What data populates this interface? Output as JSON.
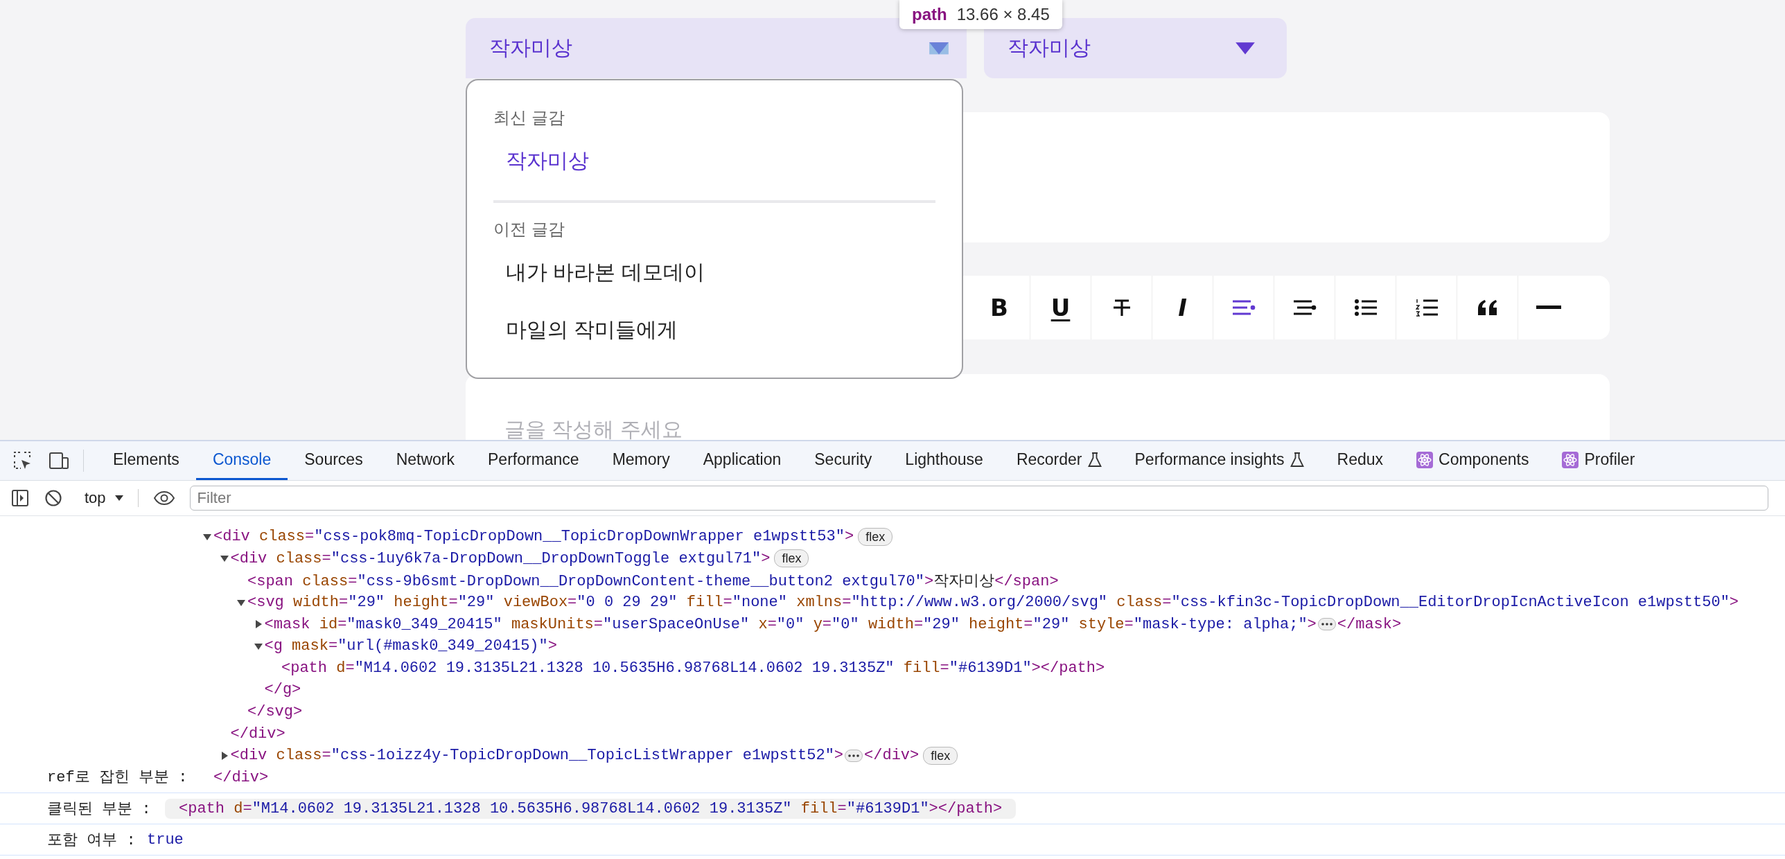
{
  "page": {
    "dropdowns": [
      {
        "label": "작자미상",
        "open": true,
        "inspected": true
      },
      {
        "label": "작자미상",
        "open": false,
        "inspected": false
      }
    ],
    "inspector_tooltip": {
      "tag": "path",
      "size": "13.66 × 8.45"
    },
    "topic_menu": {
      "groups": [
        {
          "heading": "최신 글감",
          "items": [
            {
              "label": "작자미상",
              "selected": true
            }
          ]
        },
        {
          "heading": "이전 글감",
          "items": [
            {
              "label": "내가 바라본 데모데이",
              "selected": false
            },
            {
              "label": "마일의 작미들에게",
              "selected": false
            }
          ]
        }
      ]
    },
    "format_toolbar": [
      {
        "kind": "bold",
        "label": "B",
        "selected": false
      },
      {
        "kind": "underline",
        "label": "U",
        "selected": false
      },
      {
        "kind": "strike",
        "selected": false
      },
      {
        "kind": "italic",
        "label": "I",
        "selected": false
      },
      {
        "kind": "align-left",
        "selected": true
      },
      {
        "kind": "align-right",
        "selected": false
      },
      {
        "kind": "bullet-list",
        "selected": false
      },
      {
        "kind": "numbered-list",
        "selected": false
      },
      {
        "kind": "quote",
        "selected": false
      },
      {
        "kind": "rule",
        "selected": false
      }
    ],
    "editor": {
      "placeholder": "글을 작성해 주세요"
    }
  },
  "devtools": {
    "tabs": [
      {
        "label": "Elements",
        "selected": false
      },
      {
        "label": "Console",
        "selected": true
      },
      {
        "label": "Sources",
        "selected": false
      },
      {
        "label": "Network",
        "selected": false
      },
      {
        "label": "Performance",
        "selected": false
      },
      {
        "label": "Memory",
        "selected": false
      },
      {
        "label": "Application",
        "selected": false
      },
      {
        "label": "Security",
        "selected": false
      },
      {
        "label": "Lighthouse",
        "selected": false
      },
      {
        "label": "Recorder",
        "selected": false,
        "kind": "experiment"
      },
      {
        "label": "Performance insights",
        "selected": false,
        "kind": "experiment"
      },
      {
        "label": "Redux",
        "selected": false
      },
      {
        "label": "Components",
        "selected": false,
        "kind": "extension"
      },
      {
        "label": "Profiler",
        "selected": false,
        "kind": "extension"
      }
    ],
    "console_toolbar": {
      "context": "top",
      "filter_placeholder": "Filter"
    },
    "messages": [
      {
        "kind": "tree",
        "label": "ref로 잡힌 부분 :",
        "tree": {
          "open": "<div class=\"css-pok8mq-TopicDropDown__TopicDropDownWrapper e1wpstt53\">",
          "expanded": true,
          "badge": "flex",
          "close": "</div>",
          "children": [
            {
              "open": "<div class=\"css-1uy6k7a-DropDown__DropDownToggle extgul71\">",
              "expanded": true,
              "badge": "flex",
              "close": "</div>",
              "children": [
                {
                  "open": "<span class=\"css-9b6smt-DropDown__DropDownContent-theme__button2 extgul70\">작자미상</span>"
                },
                {
                  "open": "<svg width=\"29\" height=\"29\" viewBox=\"0 0 29 29\" fill=\"none\" xmlns=\"http://www.w3.org/2000/svg\" class=\"css-kfin3c-TopicDropDown__EditorDropIcnActiveIcon e1wpstt50\">",
                  "expanded": true,
                  "close": "</svg>",
                  "children": [
                    {
                      "open": "<mask id=\"mask0_349_20415\" maskUnits=\"userSpaceOnUse\" x=\"0\" y=\"0\" width=\"29\" height=\"29\" style=\"mask-type: alpha;\">",
                      "expanded": false,
                      "close": "</mask>"
                    },
                    {
                      "open": "<g mask=\"url(#mask0_349_20415)\">",
                      "expanded": true,
                      "close": "</g>",
                      "children": [
                        {
                          "open": "<path d=\"M14.0602 19.3135L21.1328 10.5635H6.98768L14.0602 19.3135Z\" fill=\"#6139D1\"></path>"
                        }
                      ]
                    }
                  ]
                }
              ]
            },
            {
              "open": "<div class=\"css-1oizz4y-TopicDropDown__TopicListWrapper e1wpstt52\">",
              "expanded": false,
              "close": "</div>",
              "badge": "flex"
            }
          ]
        }
      },
      {
        "kind": "node",
        "label": "클릭된 부분 :",
        "value": "<path d=\"M14.0602 19.3135L21.1328 10.5635H6.98768L14.0602 19.3135Z\" fill=\"#6139D1\"></path>"
      },
      {
        "kind": "value",
        "label": "포함 여부 :",
        "value": "true"
      }
    ]
  }
}
